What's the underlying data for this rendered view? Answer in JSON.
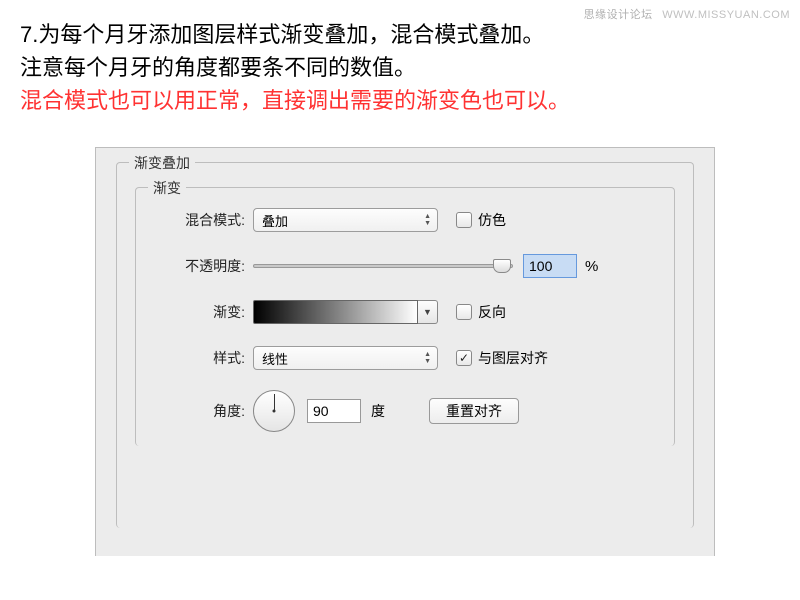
{
  "watermark": {
    "cn": "思缘设计论坛",
    "url": "WWW.MISSYUAN.COM"
  },
  "instructions": {
    "line1": "7.为每个月牙添加图层样式渐变叠加，混合模式叠加。",
    "line2": "注意每个月牙的角度都要条不同的数值。",
    "line3": "混合模式也可以用正常，直接调出需要的渐变色也可以。"
  },
  "dialog": {
    "section_title": "渐变叠加",
    "group_title": "渐变",
    "blend_label": "混合模式:",
    "blend_value": "叠加",
    "dither_label": "仿色",
    "opacity_label": "不透明度:",
    "opacity_value": "100",
    "opacity_pct": "%",
    "gradient_label": "渐变:",
    "reverse_label": "反向",
    "style_label": "样式:",
    "style_value": "线性",
    "align_label": "与图层对齐",
    "angle_label": "角度:",
    "angle_value": "90",
    "angle_unit": "度",
    "reset_align": "重置对齐"
  }
}
